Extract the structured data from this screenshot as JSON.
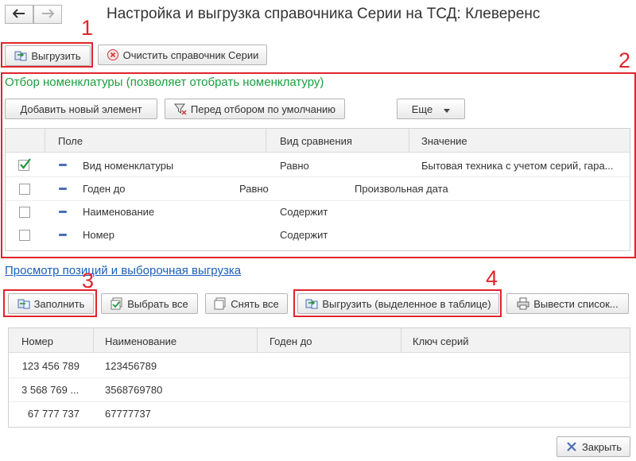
{
  "window": {
    "title": "Настройка и выгрузка справочника Серии на ТСД: Клеверенс"
  },
  "toolbar": {
    "upload_label": "Выгрузить",
    "clear_label": "Очистить справочник Серии"
  },
  "filter": {
    "heading": "Отбор номенклатуры (позволяет отобрать номенклатуру)",
    "add_label": "Добавить новый элемент",
    "default_label": "Перед отбором по умолчанию",
    "more_label": "Еще",
    "columns": [
      "Поле",
      "Вид сравнения",
      "Значение"
    ],
    "rows": [
      {
        "checked": true,
        "field": "Вид номенклатуры",
        "comparison": "Равно",
        "value": "Бытовая техника с учетом серий, гара..."
      },
      {
        "checked": false,
        "field": "Годен до",
        "comparison": "Равно",
        "value": "Произвольная дата"
      },
      {
        "checked": false,
        "field": "Наименование",
        "comparison": "Содержит",
        "value": ""
      },
      {
        "checked": false,
        "field": "Номер",
        "comparison": "Содержит",
        "value": ""
      }
    ]
  },
  "preview": {
    "link": "Просмотр позиций и выборочная выгрузка",
    "fill_label": "Заполнить",
    "select_all_label": "Выбрать все",
    "deselect_all_label": "Снять все",
    "upload_selected_label": "Выгрузить (выделенное в таблице)",
    "print_list_label": "Вывести список...",
    "columns": [
      "Номер",
      "Наименование",
      "Годен до",
      "Ключ серий"
    ],
    "rows": [
      {
        "number": "123 456 789",
        "name": "123456789",
        "expiry": "",
        "key": ""
      },
      {
        "number": "3 568 769 ...",
        "name": "3568769780",
        "expiry": "",
        "key": ""
      },
      {
        "number": "67 777 737",
        "name": "67777737",
        "expiry": "",
        "key": ""
      }
    ]
  },
  "footer": {
    "close_label": "Закрыть"
  },
  "annotations": [
    "1",
    "2",
    "3",
    "4"
  ],
  "colors": {
    "annotation_red": "#e0242c",
    "heading_green": "#1a9e3e",
    "link_blue": "#1b5fb8"
  }
}
